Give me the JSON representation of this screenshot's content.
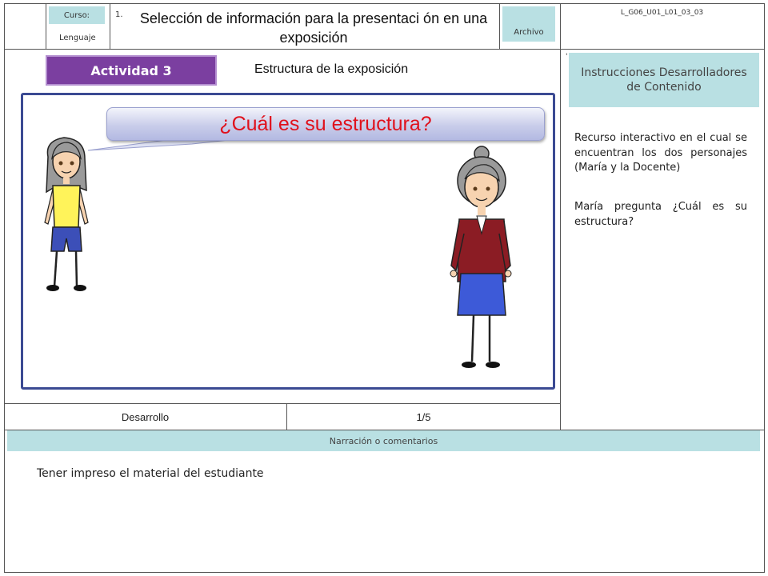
{
  "header": {
    "course_label": "Curso:",
    "course_value": "Lenguaje",
    "item_number": "1.",
    "title": "Selección de información para la presentaci ón en una exposición",
    "file_label": "Archivo",
    "file_code": "L_G06_U01_L01_03_03"
  },
  "activity": {
    "badge": "Actividad 3",
    "subtitle": "Estructura  de la exposición"
  },
  "scene": {
    "speech_text": "¿Cuál es su estructura?",
    "characters": [
      "student-girl",
      "teacher"
    ]
  },
  "instructions": {
    "header": "Instrucciones Desarrolladores de Contenido",
    "paragraph_1": "Recurso interactivo en el cual se encuentran los dos personajes (María y la Docente)",
    "paragraph_2": "María pregunta ¿Cuál es su estructura?"
  },
  "footer_row": {
    "phase": "Desarrollo",
    "page": "1/5"
  },
  "narration": {
    "header": "Narración o comentarios",
    "text": "Tener impreso el material del estudiante"
  },
  "colors": {
    "badge": "#7b3fa0",
    "cyan_box": "#b9e0e3",
    "speech_text": "#e0111c",
    "frame": "#3b4a93"
  }
}
